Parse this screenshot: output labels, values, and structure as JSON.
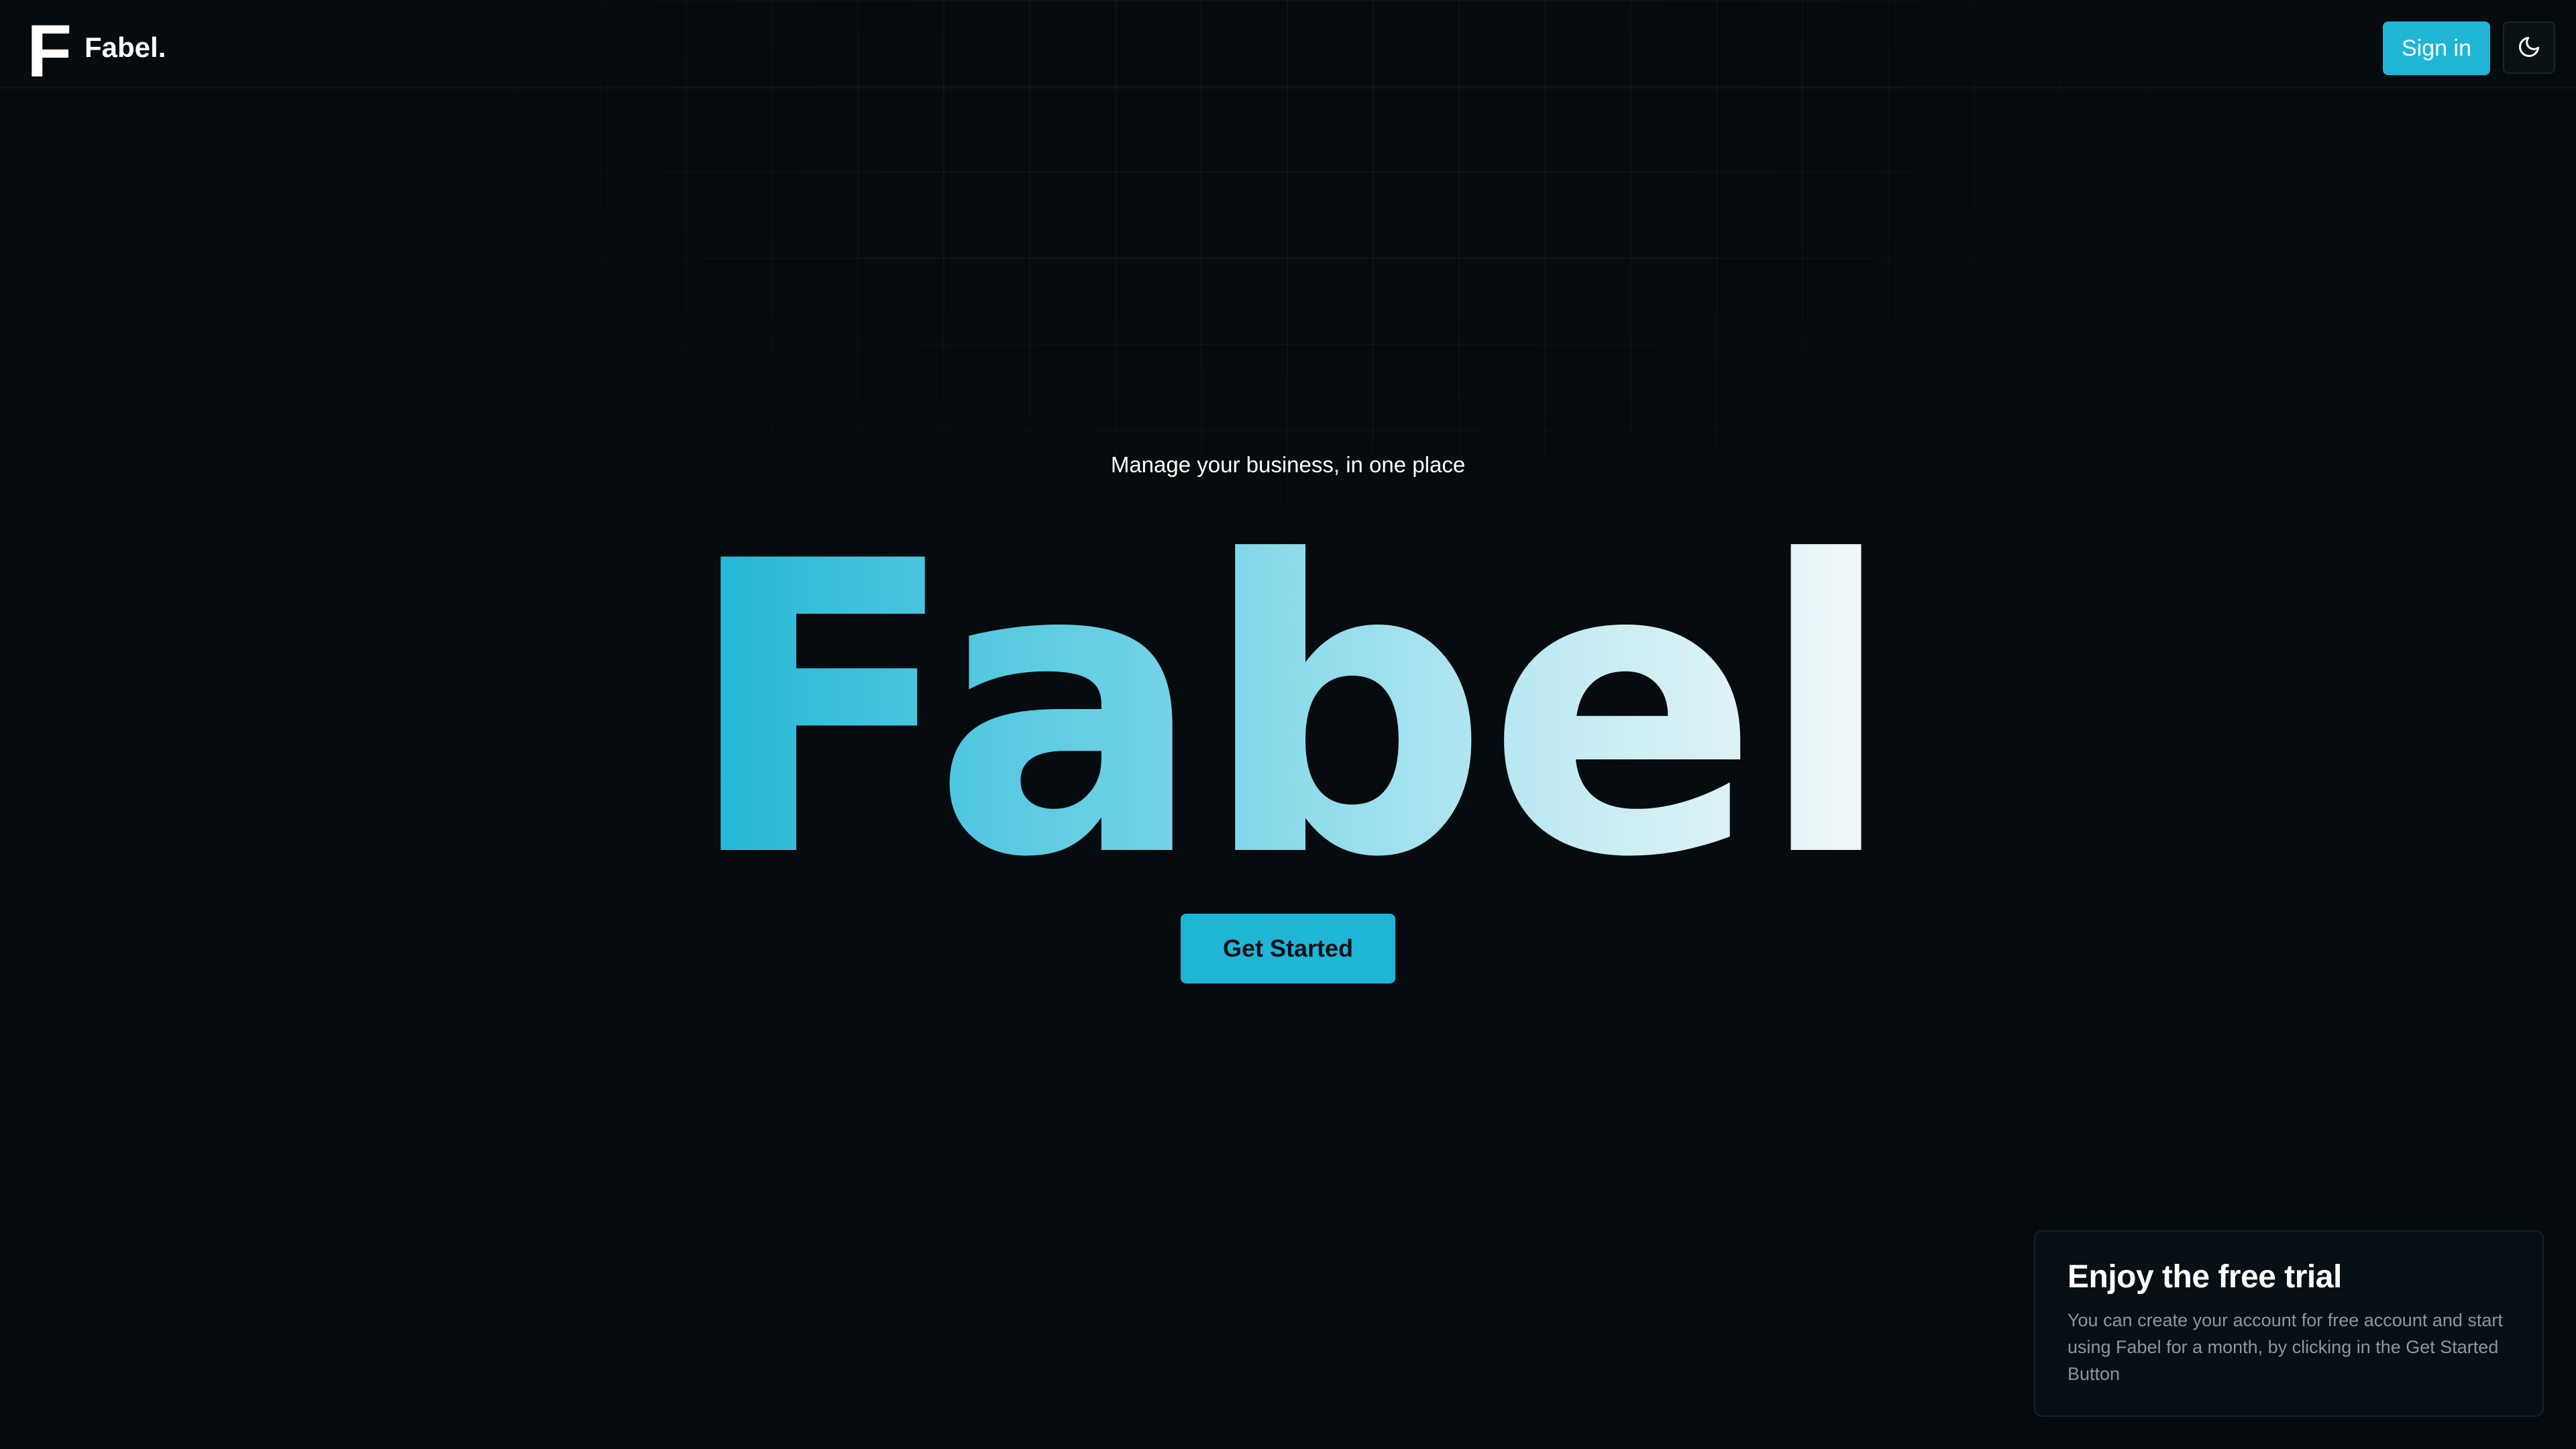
{
  "header": {
    "logo_mark": "F",
    "logo_text": "Fabel.",
    "sign_in_label": "Sign in",
    "theme_toggle_icon": "moon-icon"
  },
  "hero": {
    "tagline": "Manage your business, in one place",
    "title": "Fabel",
    "cta_label": "Get Started"
  },
  "toast": {
    "title": "Enjoy the free trial",
    "body": "You can create your account for free account and start using Fabel for a month, by clicking in the Get Started Button"
  },
  "colors": {
    "background": "#050b0e",
    "accent": "#1fb6d6",
    "title_gradient_start": "#1fb6d6",
    "title_gradient_end": "#f5f8f9"
  }
}
